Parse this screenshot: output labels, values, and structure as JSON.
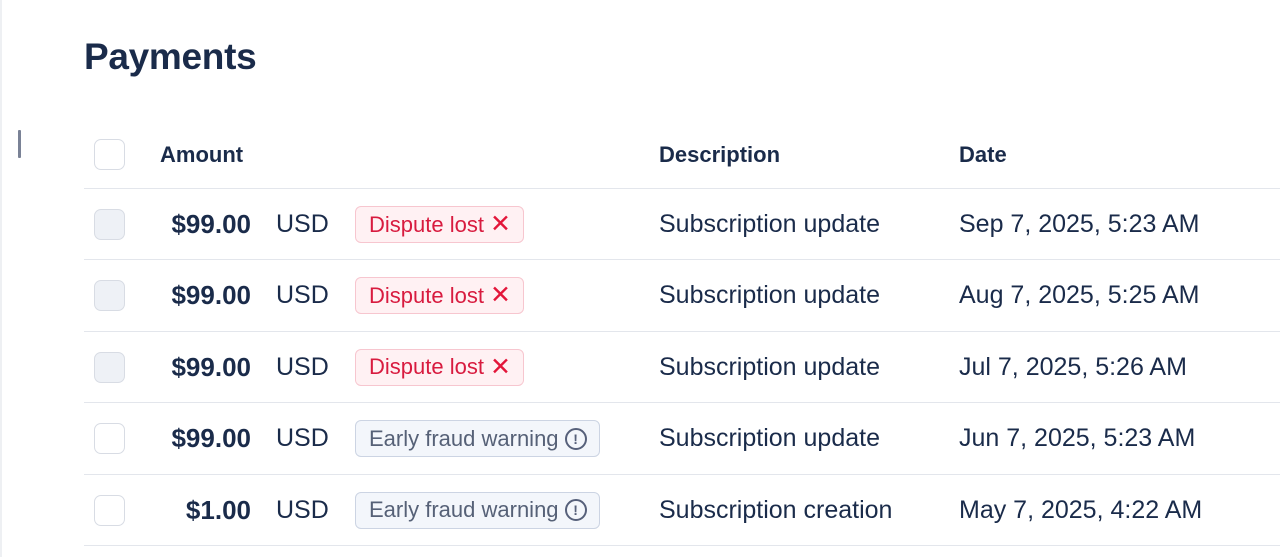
{
  "page": {
    "title": "Payments"
  },
  "table": {
    "columns": {
      "amount": "Amount",
      "description": "Description",
      "date": "Date"
    },
    "rows": [
      {
        "amount": "$99.00",
        "currency": "USD",
        "status": "Dispute lost",
        "status_icon": "x-icon",
        "description": "Subscription update",
        "date": "Sep 7, 2025, 5:23 AM"
      },
      {
        "amount": "$99.00",
        "currency": "USD",
        "status": "Dispute lost",
        "status_icon": "x-icon",
        "description": "Subscription update",
        "date": "Aug 7, 2025, 5:25 AM"
      },
      {
        "amount": "$99.00",
        "currency": "USD",
        "status": "Dispute lost",
        "status_icon": "x-icon",
        "description": "Subscription update",
        "date": "Jul 7, 2025, 5:26 AM"
      },
      {
        "amount": "$99.00",
        "currency": "USD",
        "status": "Early fraud warning",
        "status_icon": "alert-circle-icon",
        "description": "Subscription update",
        "date": "Jun 7, 2025, 5:23 AM"
      },
      {
        "amount": "$1.00",
        "currency": "USD",
        "status": "Early fraud warning",
        "status_icon": "alert-circle-icon",
        "description": "Subscription creation",
        "date": "May 7, 2025, 4:22 AM"
      }
    ]
  },
  "colors": {
    "danger_text": "#d81b3f",
    "danger_bg": "#fff1f3",
    "warning_text": "#566177",
    "warning_bg": "#f3f6fb",
    "heading": "#1a2b4a"
  }
}
